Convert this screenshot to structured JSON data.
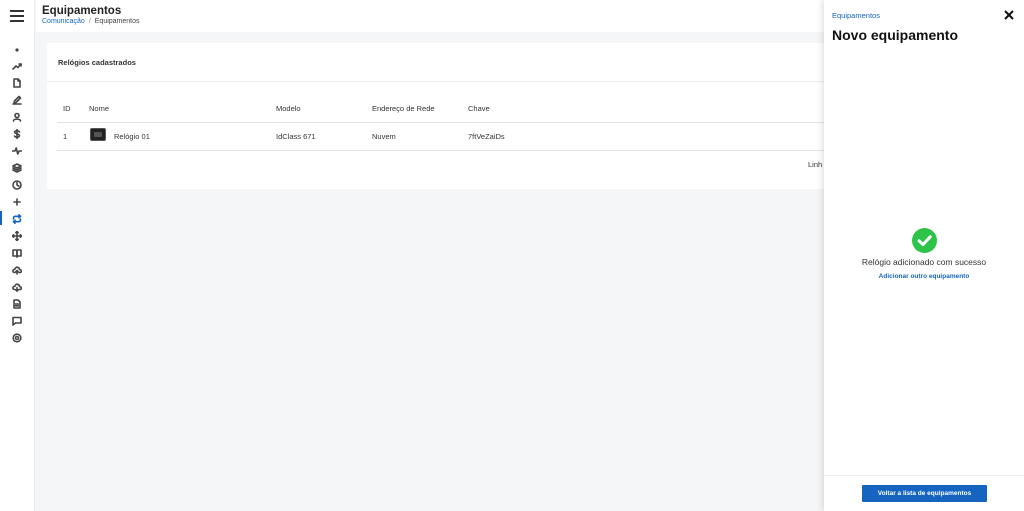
{
  "header": {
    "title": "Equipamentos",
    "breadcrumb": {
      "link": "Comunicação",
      "separator": "/",
      "current": "Equipamentos"
    }
  },
  "sidebar": {
    "icons": [
      "dot-icon",
      "trend-icon",
      "document-icon",
      "edit-icon",
      "user-icon",
      "dollar-icon",
      "activity-icon",
      "layers-icon",
      "clock-icon",
      "plus-icon",
      "repeat-icon",
      "move-icon",
      "book-icon",
      "upload-cloud-icon",
      "download-cloud-icon",
      "file-text-icon",
      "message-icon",
      "settings-icon"
    ],
    "active": "repeat-icon"
  },
  "card": {
    "title": "Relógios cadastrados",
    "columns": [
      "ID",
      "Nome",
      "Modelo",
      "Endereço de Rede",
      "Chave"
    ],
    "rows": [
      {
        "id": "1",
        "name": "Relógio 01",
        "model": "IdClass 671",
        "network": "Nuvem",
        "key": "7ftVeZaiDs"
      }
    ],
    "rows_label": "Linh"
  },
  "drawer": {
    "breadcrumb": "Equipamentos",
    "title": "Novo equipamento",
    "success_message": "Relógio adicionado com sucesso",
    "add_another": "Adicionar outro equipamento",
    "back_button": "Voltar a lista de equipamentos"
  },
  "colors": {
    "accent": "#1565c0",
    "success": "#2ec44a"
  }
}
